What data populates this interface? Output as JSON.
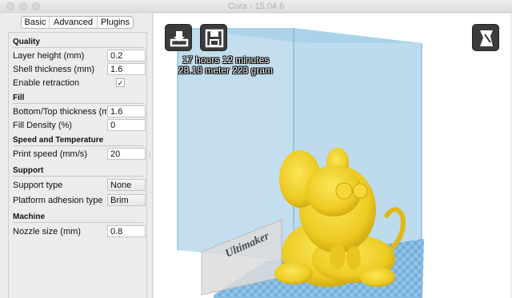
{
  "window": {
    "title": "Cura - 15.04.6"
  },
  "tabs": [
    {
      "label": "Basic",
      "active": true
    },
    {
      "label": "Advanced",
      "active": false
    },
    {
      "label": "Plugins",
      "active": false
    }
  ],
  "sections": {
    "quality": "Quality",
    "fill": "Fill",
    "speed": "Speed and Temperature",
    "support": "Support",
    "machine": "Machine"
  },
  "settings": {
    "layer_height": {
      "label": "Layer height (mm)",
      "value": "0.2"
    },
    "shell_thickness": {
      "label": "Shell thickness (mm)",
      "value": "1.6"
    },
    "enable_retraction": {
      "label": "Enable retraction",
      "checked": true,
      "mark": "✓"
    },
    "bottom_top_thickness": {
      "label": "Bottom/Top thickness (mm)",
      "value": "1.6"
    },
    "fill_density": {
      "label": "Fill Density (%)",
      "value": "0"
    },
    "print_speed": {
      "label": "Print speed (mm/s)",
      "value": "20"
    },
    "support_type": {
      "label": "Support type",
      "value": "None"
    },
    "platform_adhesion": {
      "label": "Platform adhesion type",
      "value": "Brim"
    },
    "nozzle_size": {
      "label": "Nozzle size (mm)",
      "value": "0.8"
    }
  },
  "viewport": {
    "print_time": "17 hours 12 minutes",
    "material": "28.18 meter 223 gram",
    "brand_text": "Ultimaker",
    "colors": {
      "build_volume": "#8fc3e0",
      "model": "#f0d030",
      "bed": "#8cc2e6"
    }
  },
  "icons": {
    "load": "load-model-icon",
    "save": "save-gcode-icon",
    "view_mode": "view-mode-icon"
  }
}
